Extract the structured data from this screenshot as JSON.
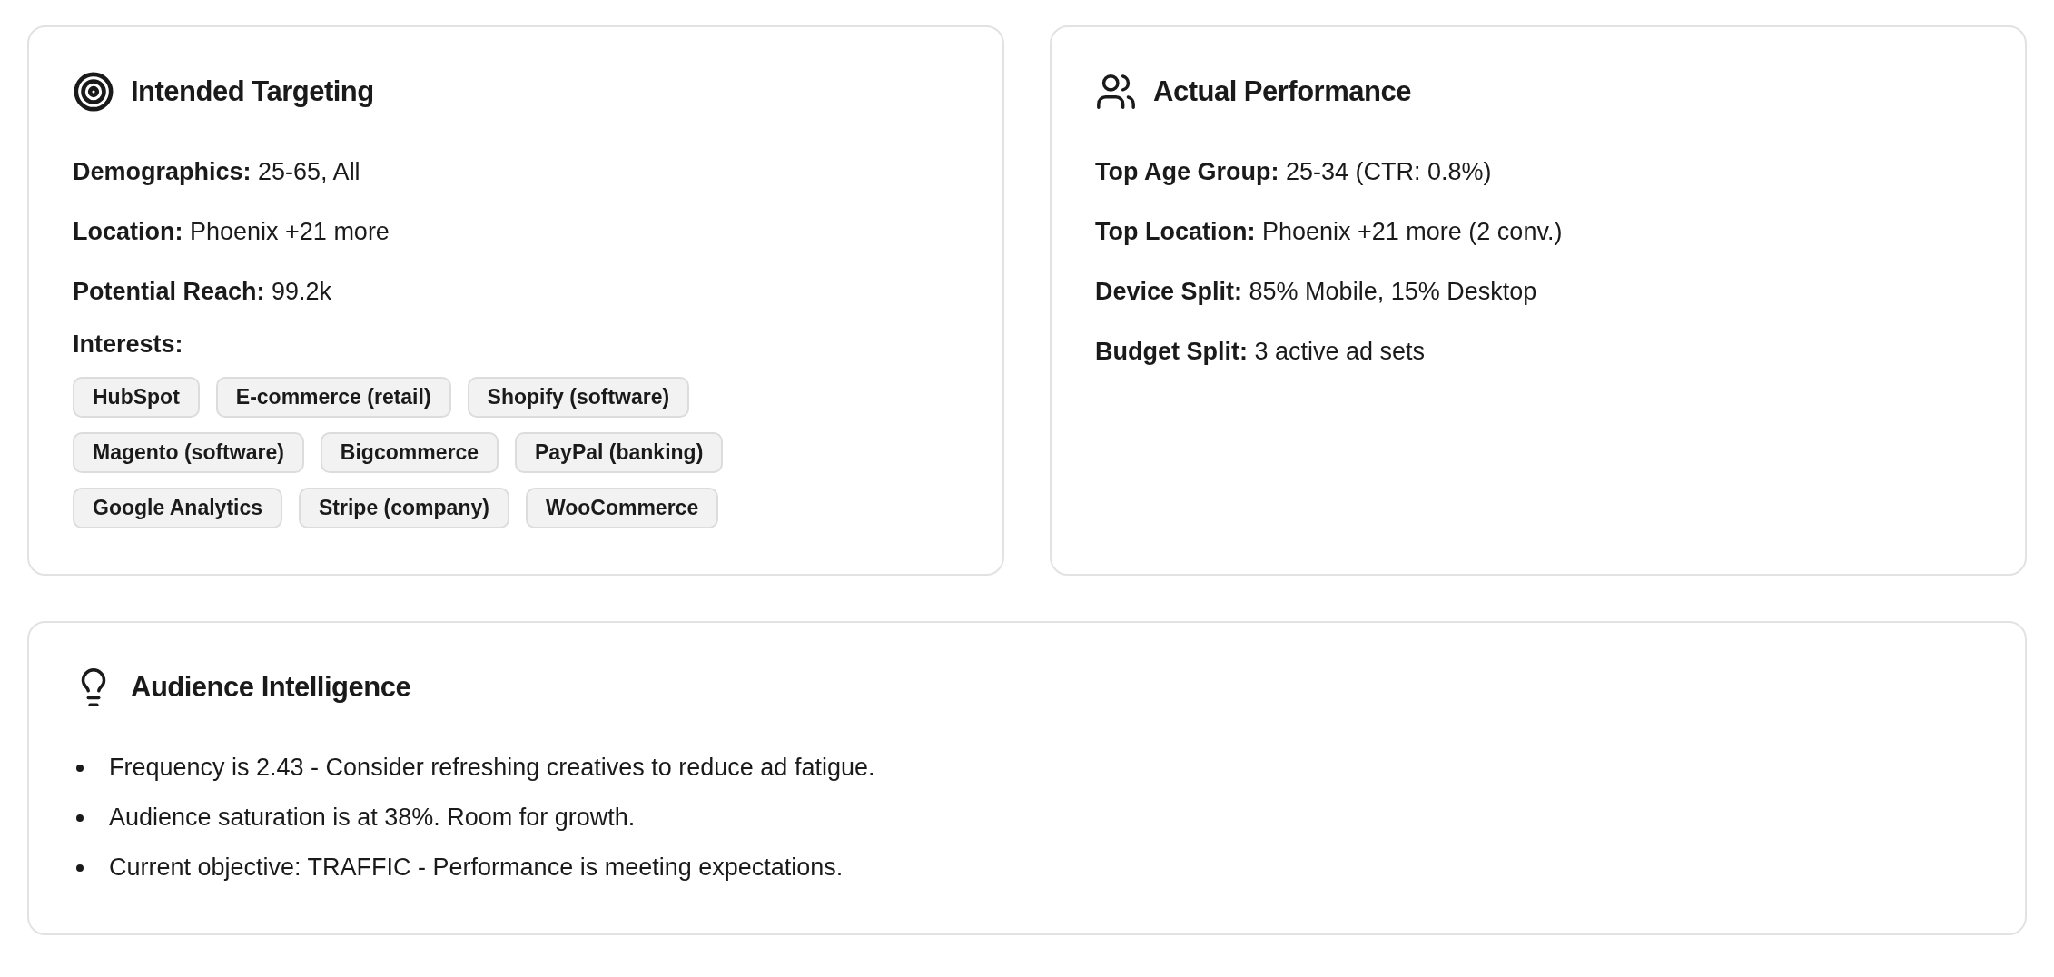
{
  "cards": [
    {
      "kind": "targeting",
      "title": "Intended Targeting",
      "fields": [
        "**Demographics:** 25-65, All",
        "**Location:** Phoenix +21 more",
        "**Potential Reach:** 99.2k"
      ],
      "interests_label": "Interests:",
      "interests": [
        "HubSpot",
        "E-commerce (retail)",
        "Shopify (software)",
        "Magento (software)",
        "Bigcommerce",
        "PayPal (banking)",
        "Google Analytics",
        "Stripe (company)",
        "WooCommerce"
      ]
    },
    {
      "kind": "performance",
      "title": "Actual Performance",
      "fields": [
        "**Top Age Group:** 25-34 (CTR: 0.8%)",
        "**Top Location:** Phoenix +21 more (2 conv.)",
        "**Device Split:** 85% Mobile, 15% Desktop",
        "**Budget Split:** 3 active ad sets"
      ]
    }
  ],
  "insights": {
    "title": "Audience Intelligence",
    "items": [
      "Frequency is 2.43 - Consider refreshing creatives to reduce ad fatigue.",
      "Audience saturation is at 38%. Room for growth.",
      "Current objective: TRAFFIC - Performance is meeting expectations."
    ]
  }
}
